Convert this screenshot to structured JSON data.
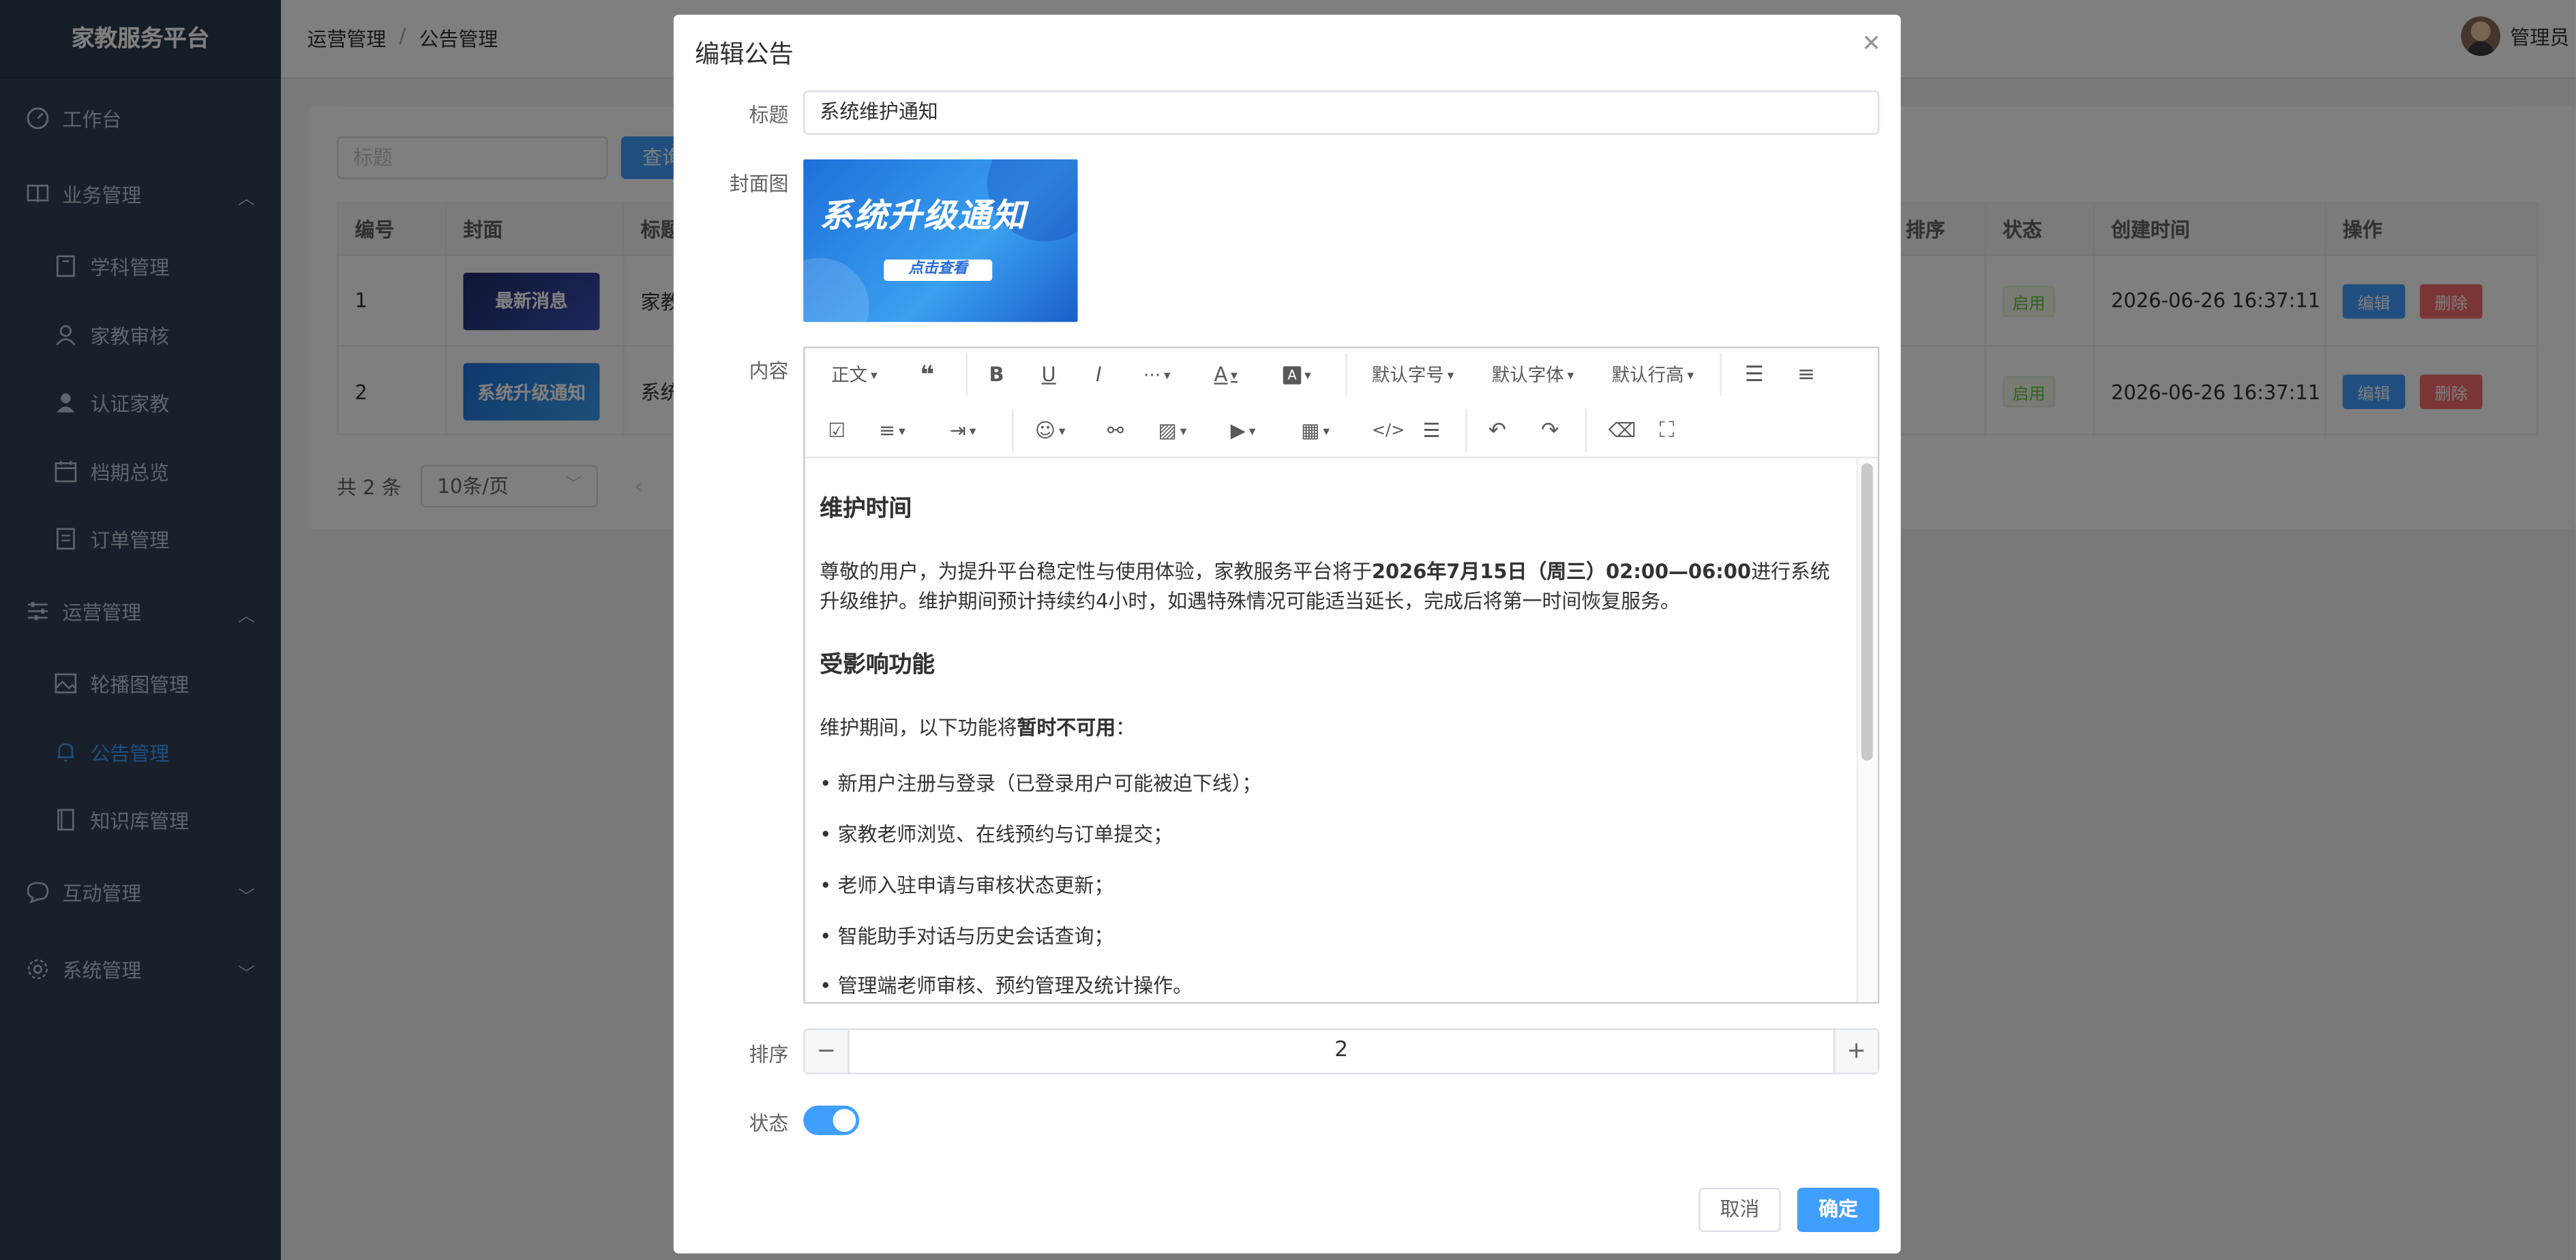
{
  "app": {
    "title": "家教服务平台",
    "user": "管理员"
  },
  "sidebar": {
    "items": [
      {
        "label": "工作台"
      },
      {
        "label": "业务管理"
      },
      {
        "label": "学科管理"
      },
      {
        "label": "家教审核"
      },
      {
        "label": "认证家教"
      },
      {
        "label": "档期总览"
      },
      {
        "label": "订单管理"
      },
      {
        "label": "运营管理"
      },
      {
        "label": "轮播图管理"
      },
      {
        "label": "公告管理"
      },
      {
        "label": "知识库管理"
      },
      {
        "label": "互动管理"
      },
      {
        "label": "系统管理"
      }
    ]
  },
  "breadcrumb": {
    "parent": "运营管理",
    "sep": "/",
    "current": "公告管理"
  },
  "search": {
    "placeholder": "标题",
    "button": "查询"
  },
  "table": {
    "headers": {
      "id": "编号",
      "cover": "封面",
      "title": "标题",
      "sort": "排序",
      "status": "状态",
      "created": "创建时间",
      "ops": "操作"
    },
    "rows": [
      {
        "id": "1",
        "cover_text": "最新消息",
        "title": "家教",
        "status": "启用",
        "created": "2026-06-26 16:37:11"
      },
      {
        "id": "2",
        "cover_text": "系统升级通知",
        "title": "系统",
        "status": "启用",
        "created": "2026-06-26 16:37:11"
      }
    ],
    "edit_label": "编辑",
    "delete_label": "删除"
  },
  "pager": {
    "total": "共 2 条",
    "size": "10条/页"
  },
  "dialog": {
    "title": "编辑公告",
    "labels": {
      "title": "标题",
      "cover": "封面图",
      "content": "内容",
      "sort": "排序",
      "status": "状态"
    },
    "title_value": "系统维护通知",
    "cover": {
      "headline": "系统升级通知",
      "button": "点击查看"
    },
    "toolbar": {
      "paragraph": "正文",
      "more": "···",
      "font_size": "默认字号",
      "font_family": "默认字体",
      "line_height": "默认行高"
    },
    "content": {
      "h1": "维护时间",
      "p1_a": "尊敬的用户，为提升平台稳定性与使用体验，家教服务平台将于",
      "p1_b": "2026年7月15日（周三）02:00—06:00",
      "p1_c": "进行系统升级维护。维护期间预计持续约4小时，如遇特殊情况可能适当延长，完成后将第一时间恢复服务。",
      "h2": "受影响功能",
      "p2_a": "维护期间，以下功能将",
      "p2_b": "暂时不可用",
      "p2_c": "：",
      "bullets": [
        "新用户注册与登录（已登录用户可能被迫下线）；",
        "家教老师浏览、在线预约与订单提交；",
        "老师入驻申请与审核状态更新；",
        "智能助手对话与历史会话查询；",
        "管理端老师审核、预约管理及统计操作。"
      ]
    },
    "sort_value": "2",
    "status_on": true,
    "cancel": "取消",
    "ok": "确定"
  },
  "colors": {
    "primary": "#409eff",
    "danger": "#f56c6c",
    "sidebar": "#304156"
  }
}
